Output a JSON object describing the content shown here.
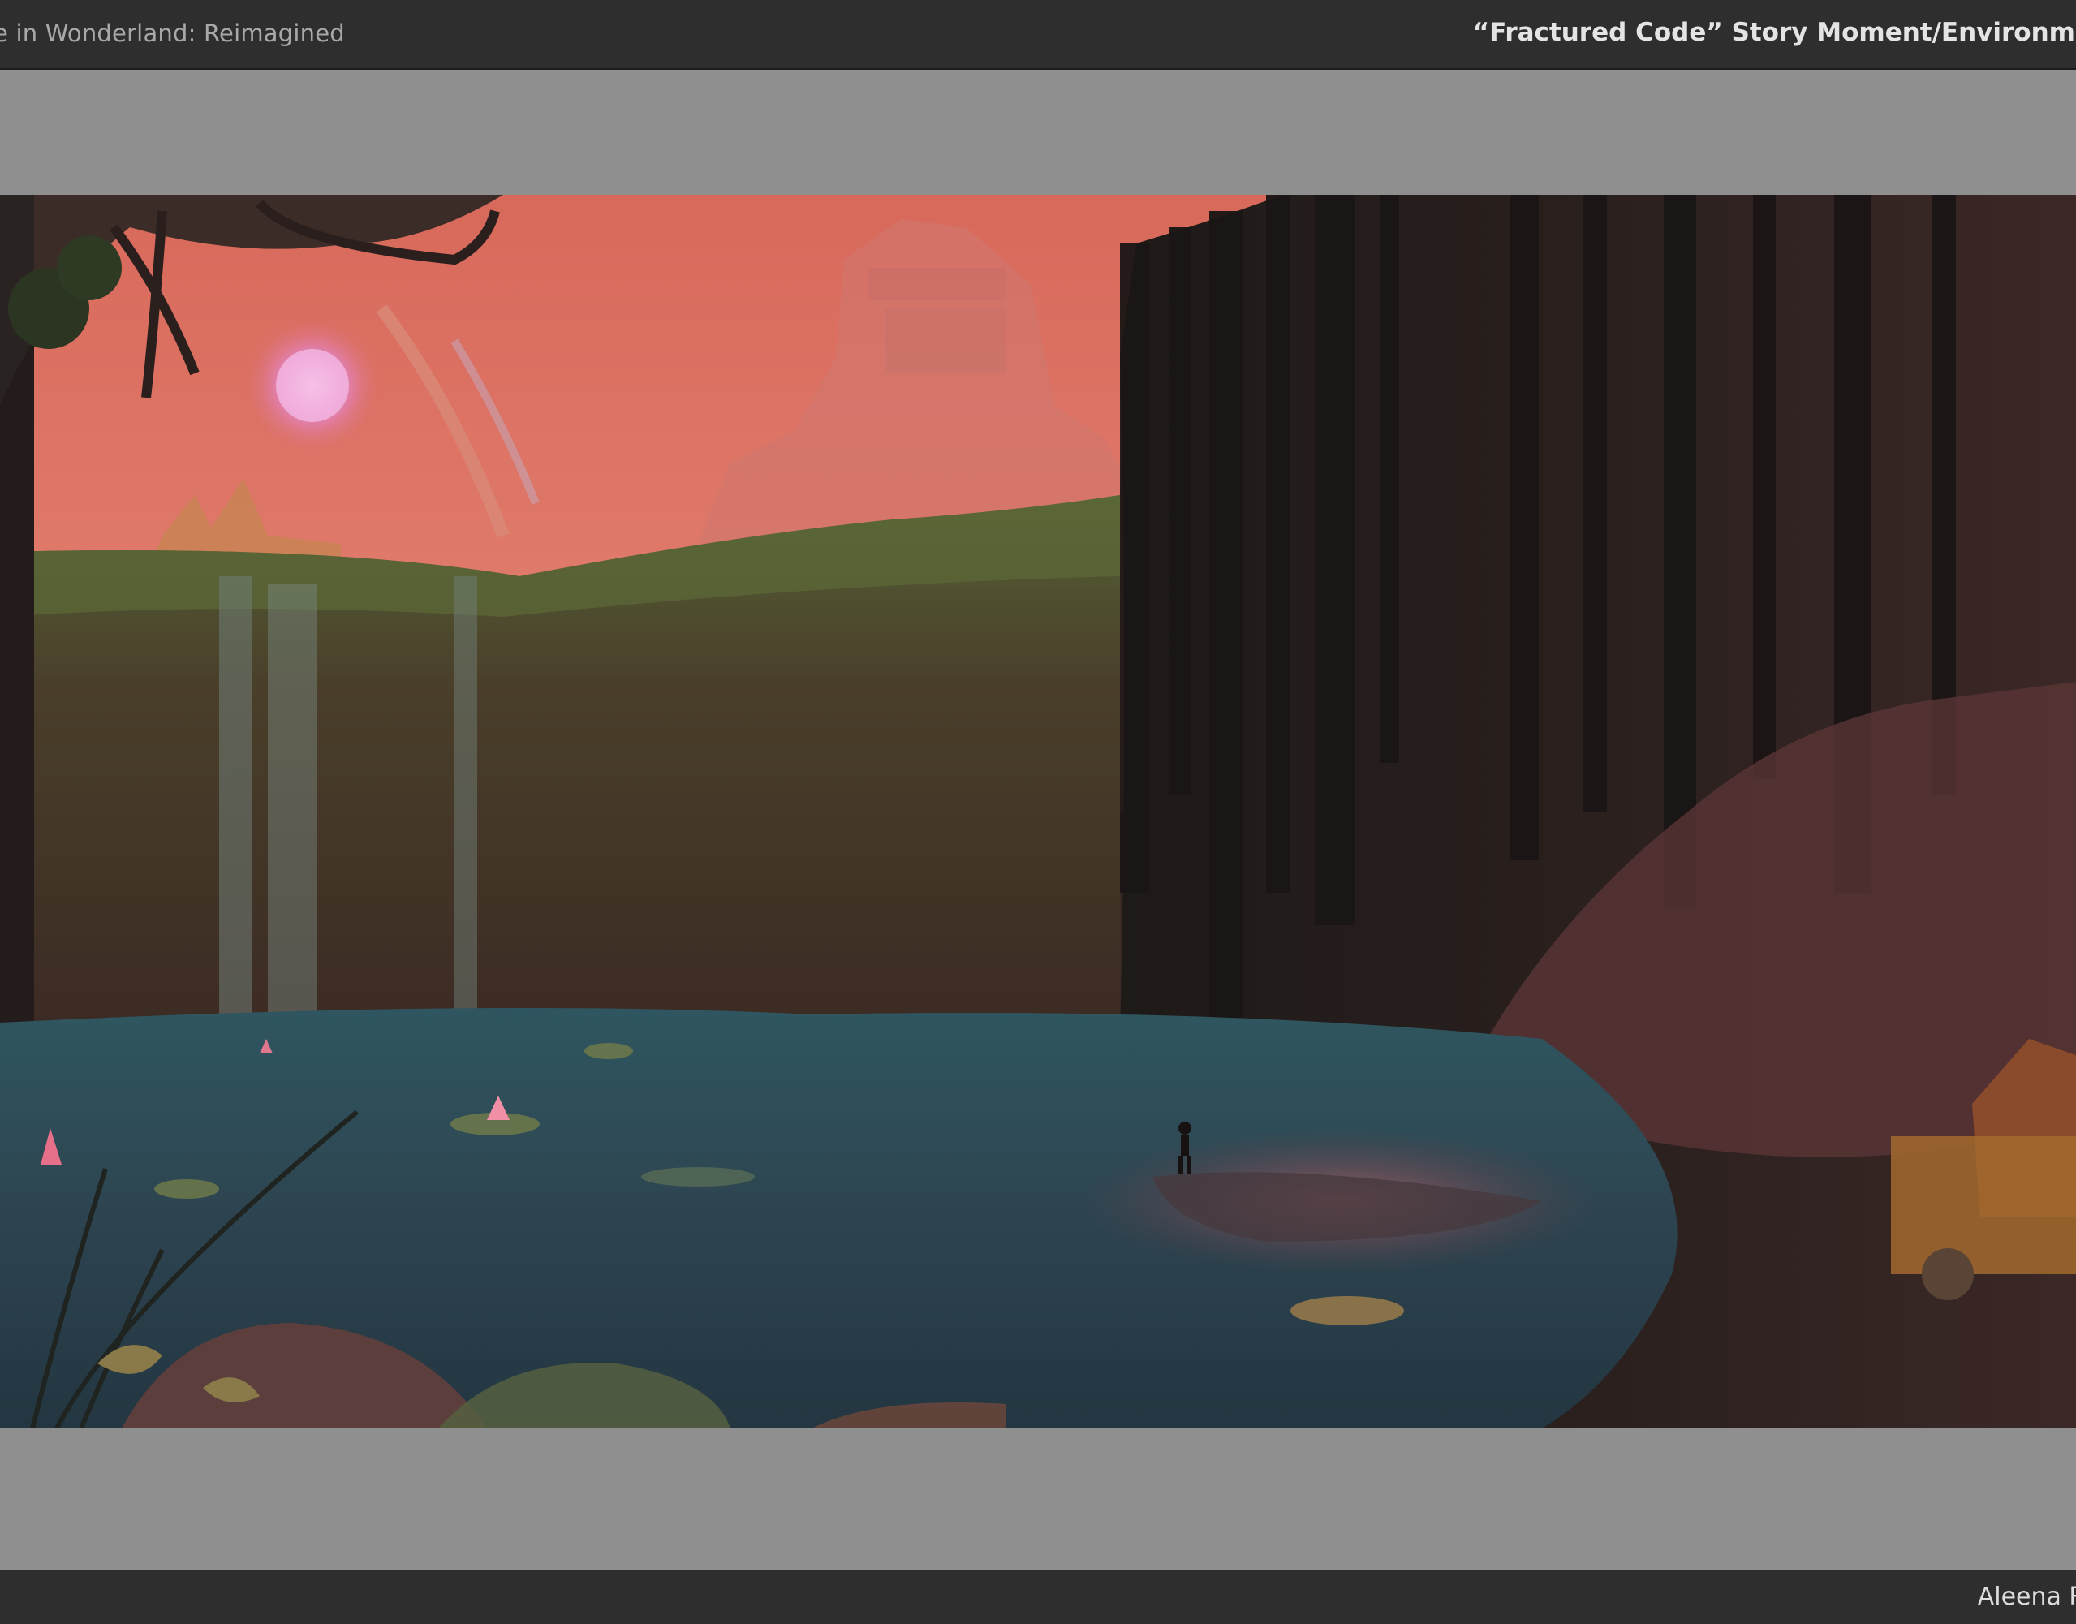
{
  "header": {
    "project_title": "e in Wonderland: Reimagined",
    "slide_title": "“Fractured Code” Story Moment/Environme"
  },
  "footer": {
    "artist_name": "Aleena Ra"
  },
  "colors": {
    "bar_bg": "#2e2e2e",
    "canvas_bg": "#8f8f8f",
    "sky_coral": "#e07565",
    "water_teal": "#2f5560",
    "cliff_olive": "#4f4a2c"
  }
}
